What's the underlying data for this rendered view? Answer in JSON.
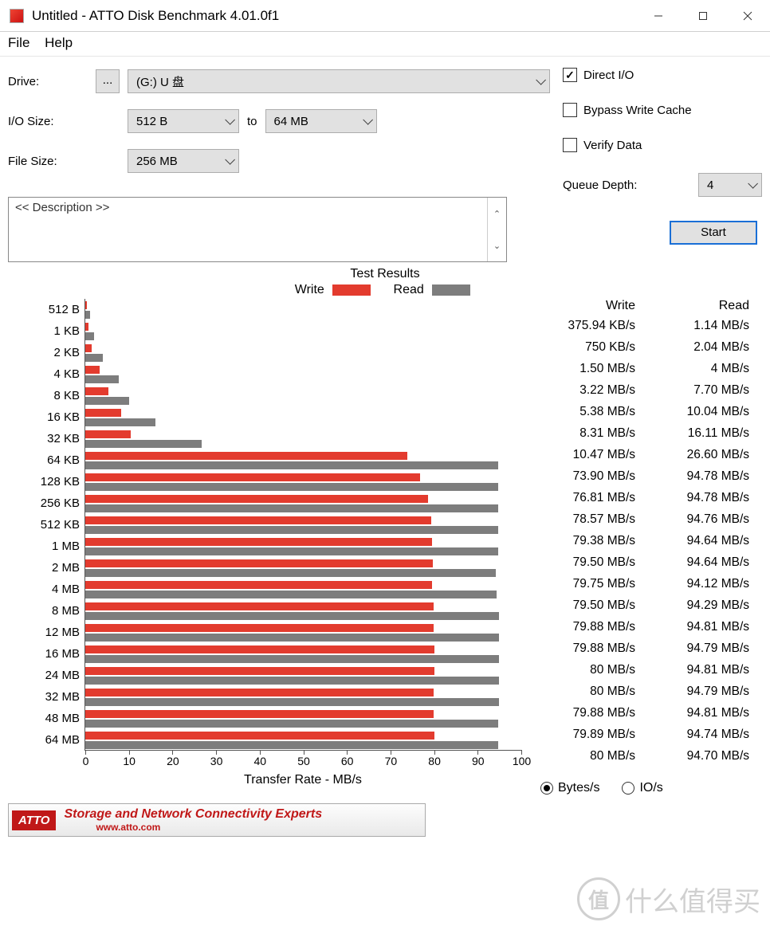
{
  "window": {
    "title": "Untitled - ATTO Disk Benchmark 4.01.0f1"
  },
  "menu": {
    "file": "File",
    "help": "Help"
  },
  "labels": {
    "drive": "Drive:",
    "iosize": "I/O Size:",
    "to": "to",
    "filesize": "File Size:",
    "directio": "Direct I/O",
    "bypass": "Bypass Write Cache",
    "verify": "Verify Data",
    "queuedepth": "Queue Depth:",
    "start": "Start",
    "description": "<< Description >>",
    "results_title": "Test Results",
    "legend_write": "Write",
    "legend_read": "Read",
    "xlabel": "Transfer Rate - MB/s",
    "col_write": "Write",
    "col_read": "Read",
    "radio_bytes": "Bytes/s",
    "radio_io": "IO/s",
    "banner_text": "Storage and Network Connectivity Experts",
    "banner_url": "www.atto.com",
    "banner_logo": "ATTO",
    "drive_browse": "...",
    "watermark": "什么值得买",
    "watermark_icon": "值"
  },
  "values": {
    "drive": "(G:) U 盘",
    "iosize_from": "512 B",
    "iosize_to": "64 MB",
    "filesize": "256 MB",
    "directio": true,
    "bypass": false,
    "verify": false,
    "queuedepth": "4",
    "radio": "bytes"
  },
  "chart_data": {
    "type": "bar",
    "title": "Test Results",
    "xlabel": "Transfer Rate - MB/s",
    "xlim": [
      0,
      100
    ],
    "xticks": [
      0,
      10,
      20,
      30,
      40,
      50,
      60,
      70,
      80,
      90,
      100
    ],
    "categories": [
      "512 B",
      "1 KB",
      "2 KB",
      "4 KB",
      "8 KB",
      "16 KB",
      "32 KB",
      "64 KB",
      "128 KB",
      "256 KB",
      "512 KB",
      "1 MB",
      "2 MB",
      "4 MB",
      "8 MB",
      "12 MB",
      "16 MB",
      "24 MB",
      "32 MB",
      "48 MB",
      "64 MB"
    ],
    "series": [
      {
        "name": "Write",
        "color": "#e33b2e",
        "values_mb": [
          0.367,
          0.732,
          1.5,
          3.22,
          5.38,
          8.31,
          10.47,
          73.9,
          76.81,
          78.57,
          79.38,
          79.5,
          79.75,
          79.5,
          79.88,
          79.88,
          80,
          80,
          79.88,
          79.89,
          80
        ],
        "display": [
          "375.94 KB/s",
          "750 KB/s",
          "1.50 MB/s",
          "3.22 MB/s",
          "5.38 MB/s",
          "8.31 MB/s",
          "10.47 MB/s",
          "73.90 MB/s",
          "76.81 MB/s",
          "78.57 MB/s",
          "79.38 MB/s",
          "79.50 MB/s",
          "79.75 MB/s",
          "79.50 MB/s",
          "79.88 MB/s",
          "79.88 MB/s",
          "80 MB/s",
          "80 MB/s",
          "79.88 MB/s",
          "79.89 MB/s",
          "80 MB/s"
        ]
      },
      {
        "name": "Read",
        "color": "#7d7d7d",
        "values_mb": [
          1.14,
          2.04,
          4,
          7.7,
          10.04,
          16.11,
          26.6,
          94.78,
          94.78,
          94.76,
          94.64,
          94.64,
          94.12,
          94.29,
          94.81,
          94.79,
          94.81,
          94.79,
          94.81,
          94.74,
          94.7
        ],
        "display": [
          "1.14 MB/s",
          "2.04 MB/s",
          "4 MB/s",
          "7.70 MB/s",
          "10.04 MB/s",
          "16.11 MB/s",
          "26.60 MB/s",
          "94.78 MB/s",
          "94.78 MB/s",
          "94.76 MB/s",
          "94.64 MB/s",
          "94.64 MB/s",
          "94.12 MB/s",
          "94.29 MB/s",
          "94.81 MB/s",
          "94.79 MB/s",
          "94.81 MB/s",
          "94.79 MB/s",
          "94.81 MB/s",
          "94.74 MB/s",
          "94.70 MB/s"
        ]
      }
    ]
  }
}
